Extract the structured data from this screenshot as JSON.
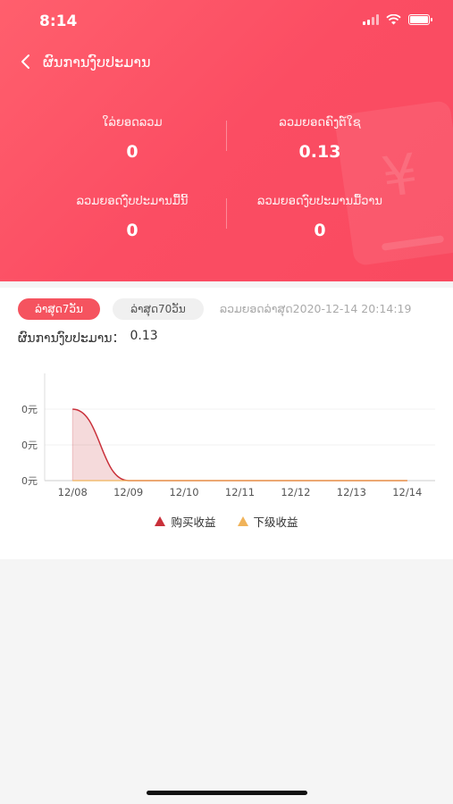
{
  "status_bar": {
    "time": "8:14"
  },
  "nav": {
    "title": "ຜົນການງົບປະມານ"
  },
  "stats": [
    {
      "label": "ໃລ່ຍອດລວມ",
      "value": "0"
    },
    {
      "label": "ລວມຍອດຄົງຕ໌ໃຊ",
      "value": "0.13"
    },
    {
      "label": "ລວມຍອດງົບປະມານມື້ນີ້",
      "value": "0"
    },
    {
      "label": "ລວມຍອດງົບປະມານມື້ວານ",
      "value": "0"
    }
  ],
  "tabs": [
    {
      "label": "ລ່າສຸດ7ວັນ",
      "active": true
    },
    {
      "label": "ລ່າສຸດ70ວັນ",
      "active": false
    }
  ],
  "update_time": "ລວມຍອດລ່າສຸດ2020-12-14 20:14:19",
  "income": {
    "label": "ຜົນການງົບປະມານ：",
    "value": "0.13"
  },
  "chart_data": {
    "type": "area",
    "x": [
      "12/08",
      "12/09",
      "12/10",
      "12/11",
      "12/12",
      "12/13",
      "12/14"
    ],
    "y_tick_labels": [
      "0元",
      "0元",
      "0元"
    ],
    "series": [
      {
        "name": "购买收益",
        "color": "#c9303a",
        "values": [
          0.13,
          0,
          0,
          0,
          0,
          0,
          0
        ]
      },
      {
        "name": "下级收益",
        "color": "#f0b35a",
        "values": [
          0,
          0,
          0,
          0,
          0,
          0,
          0
        ]
      }
    ],
    "grid": true,
    "legend": "bottom"
  },
  "colors": {
    "accent": "#f5535f",
    "header_start": "#ff5f6d",
    "header_end": "#f94a60"
  }
}
